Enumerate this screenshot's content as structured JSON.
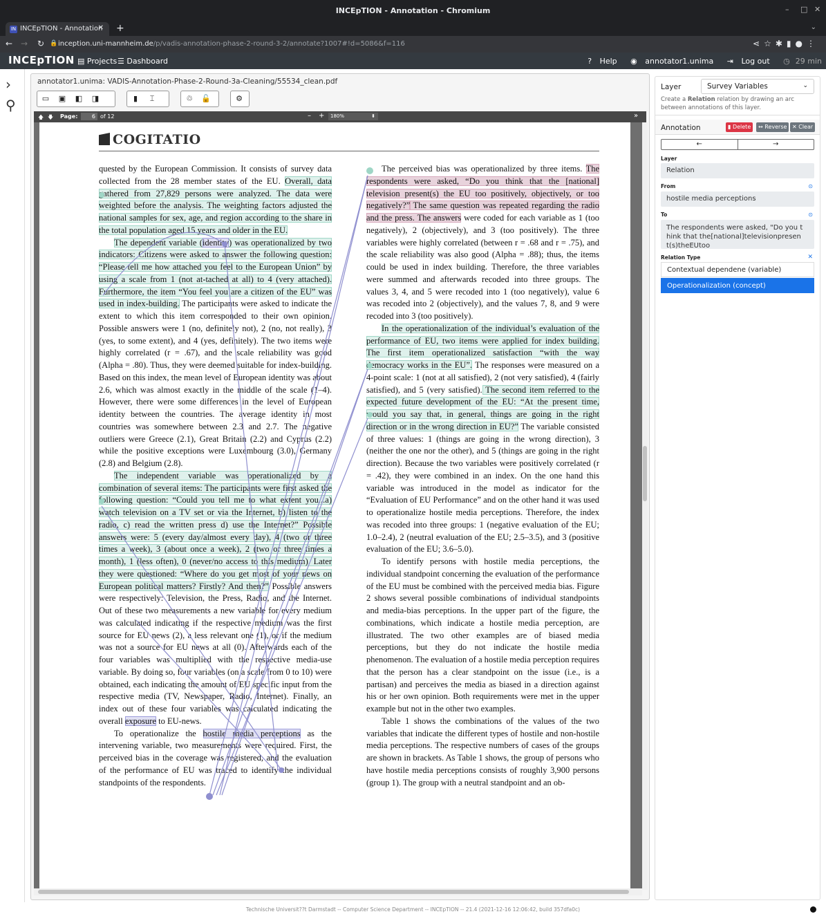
{
  "window": {
    "title": "INCEpTION - Annotation - Chromium",
    "tab_title": "INCEpTION - Annotation",
    "url_host": "inception.uni-mannheim.de",
    "url_path": "/p/vadis-annotation-phase-2-round-3-2/annotate?1007#!d=5086&f=116"
  },
  "navbar": {
    "brand": "INCEpTION",
    "projects": "Projects",
    "dashboard": "Dashboard",
    "help": "Help",
    "user": "annotator1.unima",
    "logout": "Log out",
    "timer": "29 min"
  },
  "document": {
    "name": "annotator1.unima: VADIS-Annotation-Phase-2-Round-3a-Cleaning/55534_clean.pdf",
    "page_label": "Page:",
    "page_current": "6",
    "page_total": "of 12",
    "zoom": "180%"
  },
  "pdf": {
    "journal": "COGITATIO",
    "left_column": {
      "p1a": "quested by the European Commission. It consists of survey data collected from the 28 member states of the EU. ",
      "p1b": "Overall, data gathered from 27,829 persons were analyzed. The data were weighted before the analysis. The weighting factors adjusted the national samples for sex, age, and region according to the share in the total population aged 15 years and older in the EU.",
      "p2a": "The dependent variable (",
      "p2_identity": "identity",
      "p2b": ") was operationalized by two indicators: Citizens were asked to answer the following question: “Please tell me how attached you feel to the European Union” by using a scale from 1 (not at-tached at all) to 4 (very attached). Furthermore, the item “You feel you are a citizen of the EU” was used in index-building.",
      "p2c": " The participants were asked to indicate the extent to which this item corresponded to their own opinion. Possible answers were 1 (no, definitely not), 2 (no, not really), 3 (yes, to some extent), and 4 (yes, definitely). The two items were highly correlated (r = .67), and the scale reliability was good (Alpha = .80). Thus, they were deemed suitable for index-building. Based on this index, the mean level of European identity was about 2.6, which was almost exactly in the middle of the scale (1–4). However, there were some differences in the level of European identity between the countries. The average identity in most countries was somewhere between 2.3 and 2.7. The negative outliers were Greece (2.1), Great Britain (2.2) and Cyprus (2.2) while the positive exceptions were Luxembourg (3.0), Germany (2.8) and Belgium (2.8).",
      "p3a": "The independent variable was operationalized by a combination of several items: The participants were first asked the following question: “Could you tell me to what extent you...a) watch television on a TV set or via the Internet, b) listen to the radio, c) read the written press d) use the Internet?” Possible answers were: 5 (every day/almost every day), 4 (two or three times a week), 3 (about once a week), 2 (two or three times a month), 1 (less often), 0 (never/no access to this medium). Later they were questioned: “Where do you get most of your news on European political matters? Firstly? And then?”",
      "p3b": " Possible answers were respectively: Television, the Press, Radio, and the Internet. Out of these two measurements a new variable for every medium was calculated indicating if the respective medium was the first source for EU news (2), a less relevant one (1), or if the medium was not a source for EU news at all (0). Afterwards each of the four variables was multiplied with the respective media-use variable. By doing so, four variables (on a scale from 0 to 10) were obtained, each indicating the amount of EU specific input from the respective media (TV, Newspaper, Radio, Internet). Finally, an index out of these four variables was calculated indicating the overall ",
      "p3_exposure": "exposure",
      "p3c": " to EU-news.",
      "p4a": "To operationalize the ",
      "p4_hmp": "hostile media perceptions",
      "p4b": " as the intervening variable, two measurements were required. First, the perceived bias in the coverage was registered, and the evaluation of the performance of EU was traced to identify the individual standpoints of the respondents."
    },
    "right_column": {
      "r1a": "The perceived bias was operationalized by three items. ",
      "r1b": "The respondents were asked, “Do you think that the [national] television present(s) the EU too positively, objectively, or too negatively?”",
      "r1c": " The same question was repeated regarding the radio and the press. The answers",
      "r1d": " were coded for each variable as 1 (too negatively), 2 (objectively), and 3 (too positively). The three variables were highly correlated (between r = .68 and r = .75), and the scale reliability was also good (Alpha = .88); thus, the items could be used in index building. Therefore, the three variables were summed and afterwards recoded into three groups. The values 3, 4, and 5 were recoded into 1 (too negatively), value 6 was recoded into 2 (objectively), and the values 7, 8, and 9 were recoded into 3 (too positively).",
      "r2a": "In the operationalization of the individual’s evaluation of the performance of EU, two items were applied for index building. The first item operationalized satisfaction “with the way democracy works in the EU”.",
      "r2b": " The responses were measured on a 4-point scale: 1 (not at all satisfied), 2 (not very satisfied), 4 (fairly satisfied), and 5 (very satisfied).",
      "r2c": " The second item referred to the expected future development of the EU: “At the present time, would you say that, in general, things are going in the right direction or in the wrong direction in EU?”",
      "r2d": " The variable consisted of three values: 1 (things are going in the wrong direction), 3 (neither the one nor the other), and 5 (things are going in the right direction). Because the two variables were positively correlated (r = .42), they were combined in an index. On the one hand this variable was introduced in the model as indicator for the “Evaluation of EU Performance” and on the other hand it was used to operationalize hostile media perceptions. Therefore, the index was recoded into three groups: 1 (negative evaluation of the EU; 1.0–2.4), 2 (neutral evaluation of the EU; 2.5–3.5), and 3 (positive evaluation of the EU; 3.6–5.0).",
      "r3": "To identify persons with hostile media perceptions, the individual standpoint concerning the evaluation of the performance of the EU must be combined with the perceived media bias. Figure 2 shows several possible combinations of individual standpoints and media-bias perceptions. In the upper part of the figure, the combinations, which indicate a hostile media perception, are illustrated. The two other examples are of biased media perceptions, but they do not indicate the hostile media phenomenon. The evaluation of a hostile media perception requires that the person has a clear standpoint on the issue (i.e., is a partisan) and perceives the media as biased in a direction against his or her own opinion. Both requirements were met in the upper example but not in the other two examples.",
      "r4": "Table 1 shows the combinations of the values of the two variables that indicate the different types of hostile and non-hostile media perceptions. The respective numbers of cases of the groups are shown in brackets. As Table 1 shows, the group of persons who have hostile media perceptions consists of roughly 3,900 persons (group 1). The group with a neutral standpoint and an ob-"
    }
  },
  "sidebar": {
    "layer_label": "Layer",
    "layer_value": "Survey Variables",
    "hint_pre": "Create a ",
    "hint_bold": "Relation",
    "hint_post": " relation by drawing an arc between annotations of this layer.",
    "annotation_title": "Annotation",
    "delete": "Delete",
    "reverse": "Reverse",
    "clear": "Clear",
    "prev": "←",
    "next": "→",
    "f_layer_label": "Layer",
    "f_layer_value": "Relation",
    "from_label": "From",
    "from_value": "hostile media perceptions",
    "to_label": "To",
    "to_value": "The respondents were asked, \"Do you think that the[national]televisionpresent(s)theEUtoo",
    "reltype_label": "Relation Type",
    "reltype_options": [
      "Contextual dependene (variable)",
      "Operationalization (concept)"
    ]
  },
  "footer": "Technische Universit??t Darmstadt -- Computer Science Department -- INCEpTION -- 21.4 (2021-12-16 12:06:42, build 357dfa0c)"
}
